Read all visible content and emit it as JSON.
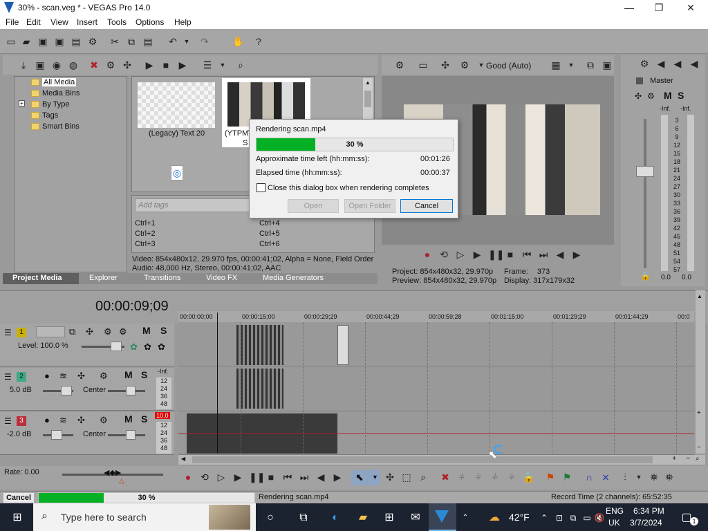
{
  "window": {
    "title": "30% - scan.veg * - VEGAS Pro 14.0",
    "minimize": "—",
    "maximize": "❐",
    "close": "✕"
  },
  "menu": [
    "File",
    "Edit",
    "View",
    "Insert",
    "Tools",
    "Options",
    "Help"
  ],
  "media_tree": {
    "items": [
      "All Media",
      "Media Bins",
      "By Type",
      "Tags",
      "Smart Bins"
    ],
    "expand": "+"
  },
  "media": {
    "thumb1_label": "(Legacy) Text 20",
    "thumb2_label_a": "(YTPM\\",
    "thumb2_label_b": "S",
    "tags_placeholder": "Add tags",
    "shortcuts_left": [
      "Ctrl+1",
      "Ctrl+2",
      "Ctrl+3"
    ],
    "shortcuts_right": [
      "Ctrl+4",
      "Ctrl+5",
      "Ctrl+6"
    ],
    "info_video": "Video: 854x480x12, 29.970 fps, 00:00:41;02, Alpha = None, Field Order",
    "info_audio": "Audio: 48,000 Hz, Stereo, 00:00:41;02, AAC"
  },
  "tabs": [
    "Project Media",
    "Explorer",
    "Transitions",
    "Video FX",
    "Media Generators"
  ],
  "dialog": {
    "title": "Rendering scan.mp4",
    "progress_text": "30 %",
    "progress": 0.3,
    "time_left_label": "Approximate time left (hh:mm:ss):",
    "time_left": "00:01:26",
    "elapsed_label": "Elapsed time (hh:mm:ss):",
    "elapsed": "00:00:37",
    "close_checkbox": "Close this dialog box when rendering completes",
    "open": "Open",
    "open_folder": "Open Folder",
    "cancel": "Cancel"
  },
  "preview": {
    "quality": "Good (Auto)",
    "project_label": "Project:",
    "project": "854x480x32, 29.970p",
    "frame_label": "Frame:",
    "frame": "373",
    "preview_label": "Preview:",
    "preview": "854x480x32, 29.970p",
    "display_label": "Display:",
    "display": "317x179x32"
  },
  "master": {
    "label": "Master",
    "m": "M",
    "s": "S",
    "inf_left": "-Inf.",
    "inf_right": "-Inf.",
    "scale": [
      "3",
      "6",
      "9",
      "12",
      "15",
      "18",
      "21",
      "24",
      "27",
      "30",
      "33",
      "36",
      "39",
      "42",
      "45",
      "48",
      "51",
      "54",
      "57"
    ],
    "val_left": "0.0",
    "val_right": "0.0"
  },
  "timeline": {
    "timecode": "00:00:09;09",
    "ruler": [
      "00:00:00;00",
      "00:00:15;00",
      "00:00:29;29",
      "00:00:44;29",
      "00:00:59;28",
      "00:01:15;00",
      "00:01:29;29",
      "00:01:44;29",
      "00:0"
    ],
    "tracks": [
      {
        "num": "1",
        "color": "#c9b100",
        "level": "Level: 100.0 %"
      },
      {
        "num": "2",
        "color": "#3fa987",
        "vol": "5.0 dB",
        "pan": "Center",
        "peak": "-Inf."
      },
      {
        "num": "3",
        "color": "#b9303a",
        "vol": "-2.0 dB",
        "pan": "Center",
        "peak": "10.0"
      }
    ],
    "meter_scale": [
      "12",
      "24",
      "36",
      "48"
    ]
  },
  "transport": {
    "rate": "Rate: 0.00"
  },
  "status": {
    "cancel": "Cancel",
    "progress_text": "30 %",
    "progress": 0.3,
    "message": "Rendering scan.mp4",
    "record_time": "Record Time (2 channels): 65:52:35"
  },
  "taskbar": {
    "search": "Type here to search",
    "temperature": "42°F",
    "lang1": "ENG",
    "lang2": "UK",
    "time": "6:34 PM",
    "date": "3/7/2024",
    "notification_count": "1"
  },
  "colors": {
    "progress": "#06b025",
    "dialog_bg": "#f0f0f0",
    "taskbar": "#1c2330",
    "panel": "#a0a0a0"
  }
}
